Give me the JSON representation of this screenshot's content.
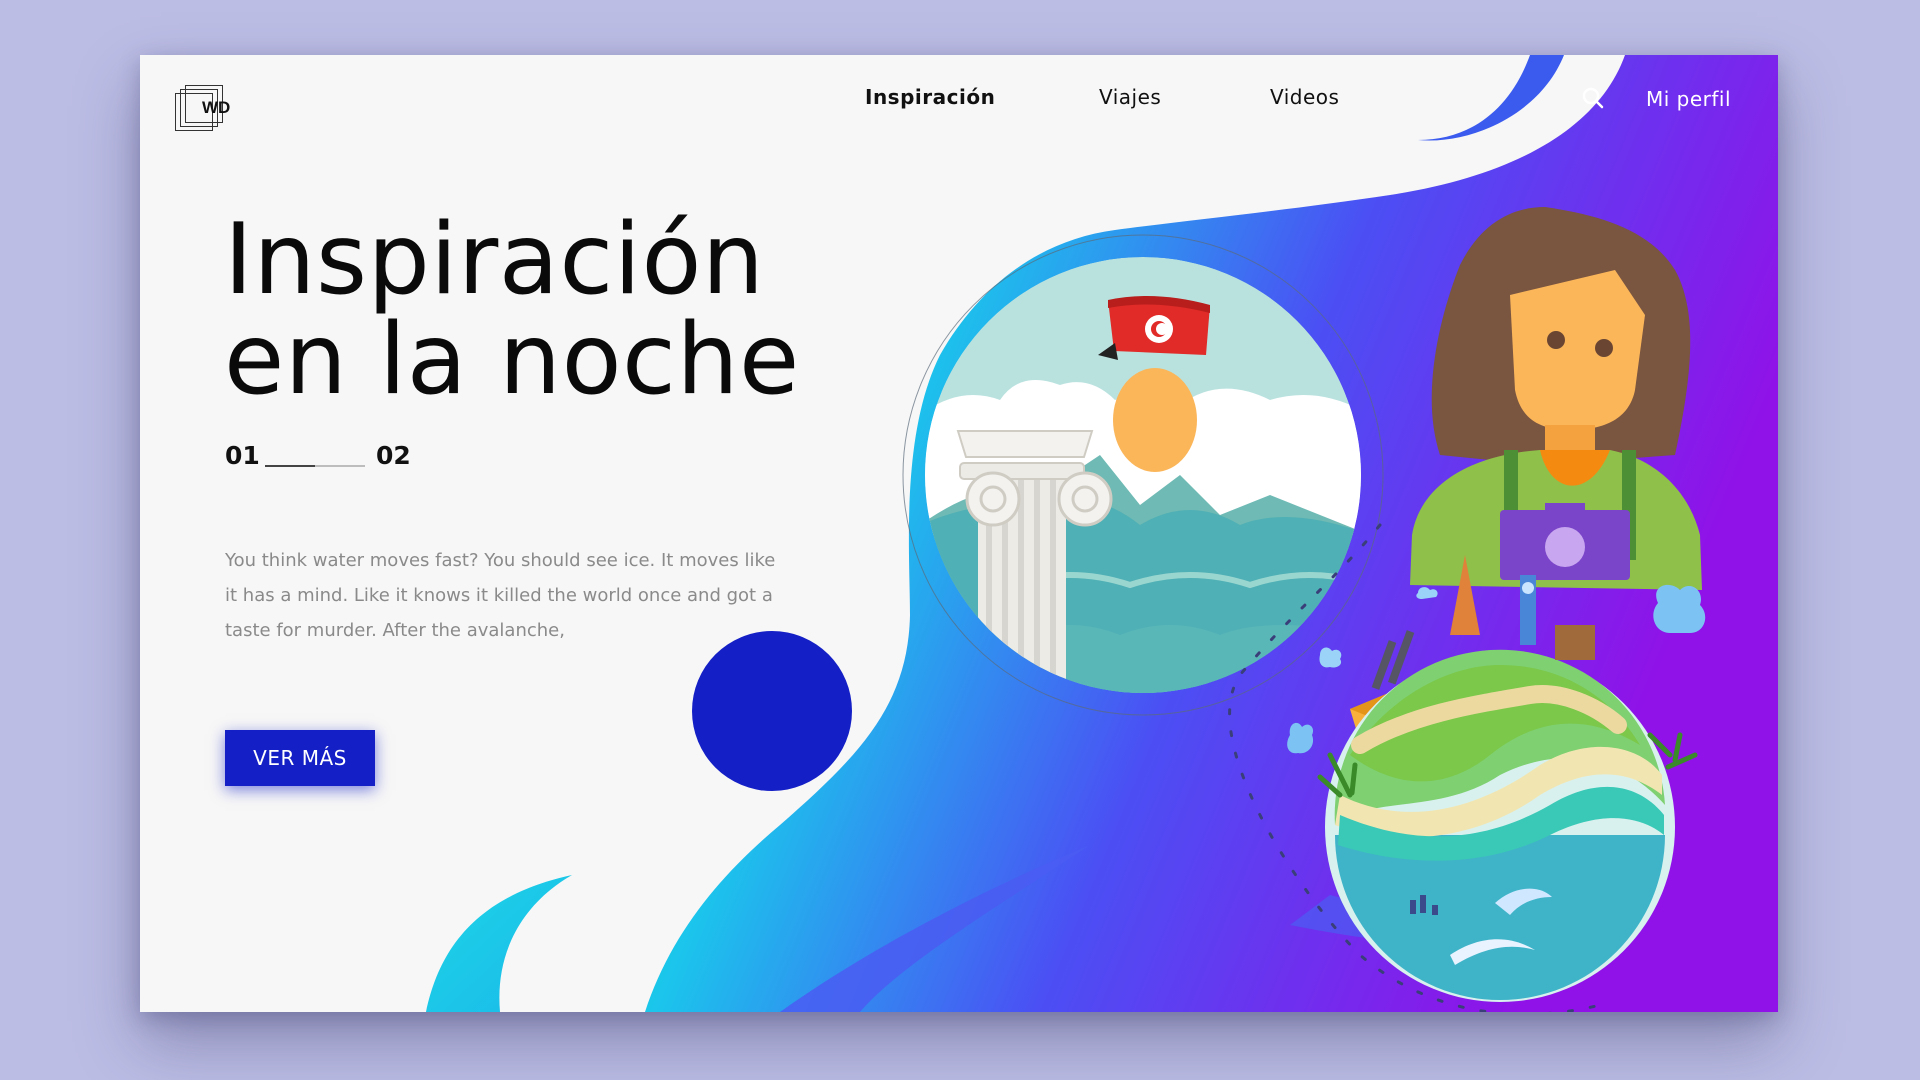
{
  "logo": {
    "text": "WD"
  },
  "nav": {
    "items": [
      {
        "label": "Inspiración",
        "active": true
      },
      {
        "label": "Viajes",
        "active": false
      },
      {
        "label": "Videos",
        "active": false
      }
    ],
    "search_icon": "search-icon",
    "profile_label": "Mi perfil"
  },
  "hero": {
    "title_line1": "Inspiración",
    "title_line2": "en la noche",
    "pager": {
      "current": "01",
      "next": "02",
      "progress": 0.5
    },
    "description": "You think water moves fast? You should see ice. It moves like it has a mind. Like it knows it killed the world once and got a taste for murder. After the avalanche,",
    "cta_label": "VER MÁS"
  },
  "colors": {
    "accent_blue": "#1420c6",
    "gradient_teal": "#14e6c0",
    "gradient_cyan": "#1ec8ea",
    "gradient_purple": "#8d10ea",
    "background": "#bcbde5"
  }
}
